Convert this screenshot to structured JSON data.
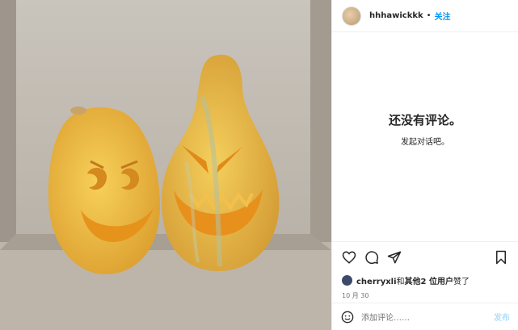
{
  "header": {
    "username": "hhhawickkk",
    "dot": "•",
    "follow_label": "关注"
  },
  "comments": {
    "empty_title": "还没有评论。",
    "empty_subtitle": "发起对话吧。"
  },
  "actions": {
    "icons": [
      "heart-icon",
      "comment-icon",
      "share-icon",
      "bookmark-icon"
    ]
  },
  "likes": {
    "user": "cherryxli",
    "and": "和",
    "others": "其他2 位用户",
    "suffix": "赞了"
  },
  "date": "10 月 30",
  "comment_box": {
    "placeholder": "添加评论……",
    "post_label": "发布"
  },
  "colors": {
    "accent": "#0095f6",
    "post_disabled": "#b2dffc"
  }
}
